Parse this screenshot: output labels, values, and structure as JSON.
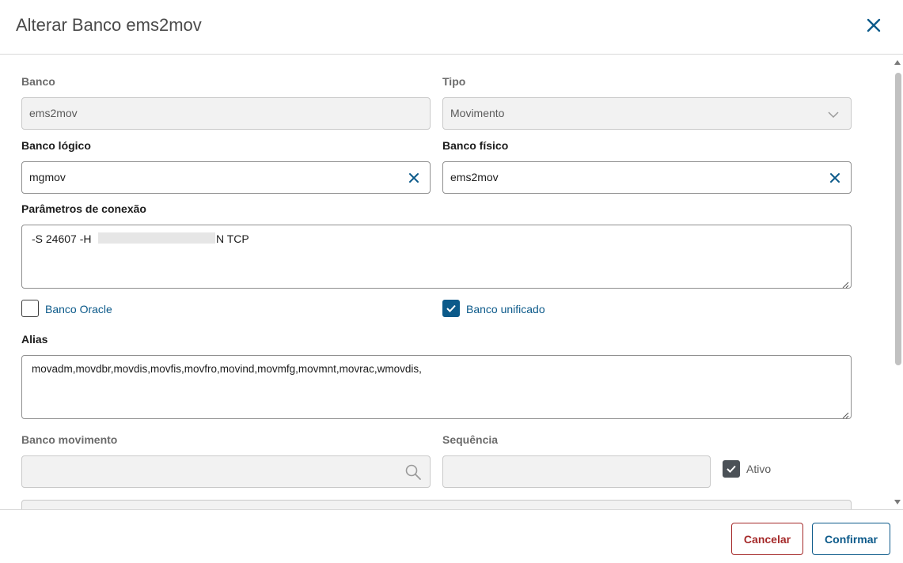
{
  "dialog": {
    "title": "Alterar Banco ems2mov",
    "close_icon": "close-icon"
  },
  "form": {
    "banco": {
      "label": "Banco",
      "value": "ems2mov"
    },
    "tipo": {
      "label": "Tipo",
      "value": "Movimento"
    },
    "banco_logico": {
      "label": "Banco lógico",
      "value": "mgmov"
    },
    "banco_fisico": {
      "label": "Banco físico",
      "value": "ems2mov"
    },
    "parametros": {
      "label": "Parâmetros de conexão",
      "value_prefix": "-S 24607 -H",
      "value_suffix": "N TCP"
    },
    "banco_oracle": {
      "label": "Banco Oracle",
      "checked": false
    },
    "banco_unificado": {
      "label": "Banco unificado",
      "checked": true
    },
    "alias": {
      "label": "Alias",
      "value": "movadm,movdbr,movdis,movfis,movfro,movind,movmfg,movmnt,movrac,wmovdis,"
    },
    "banco_movimento": {
      "label": "Banco movimento",
      "value": ""
    },
    "sequencia": {
      "label": "Sequência",
      "value": ""
    },
    "ativo": {
      "label": "Ativo",
      "checked": true
    }
  },
  "footer": {
    "cancel_label": "Cancelar",
    "confirm_label": "Confirmar"
  },
  "colors": {
    "primary": "#0c5a8a",
    "danger": "#a52a2a",
    "disabled_bg": "#f2f2f2"
  }
}
